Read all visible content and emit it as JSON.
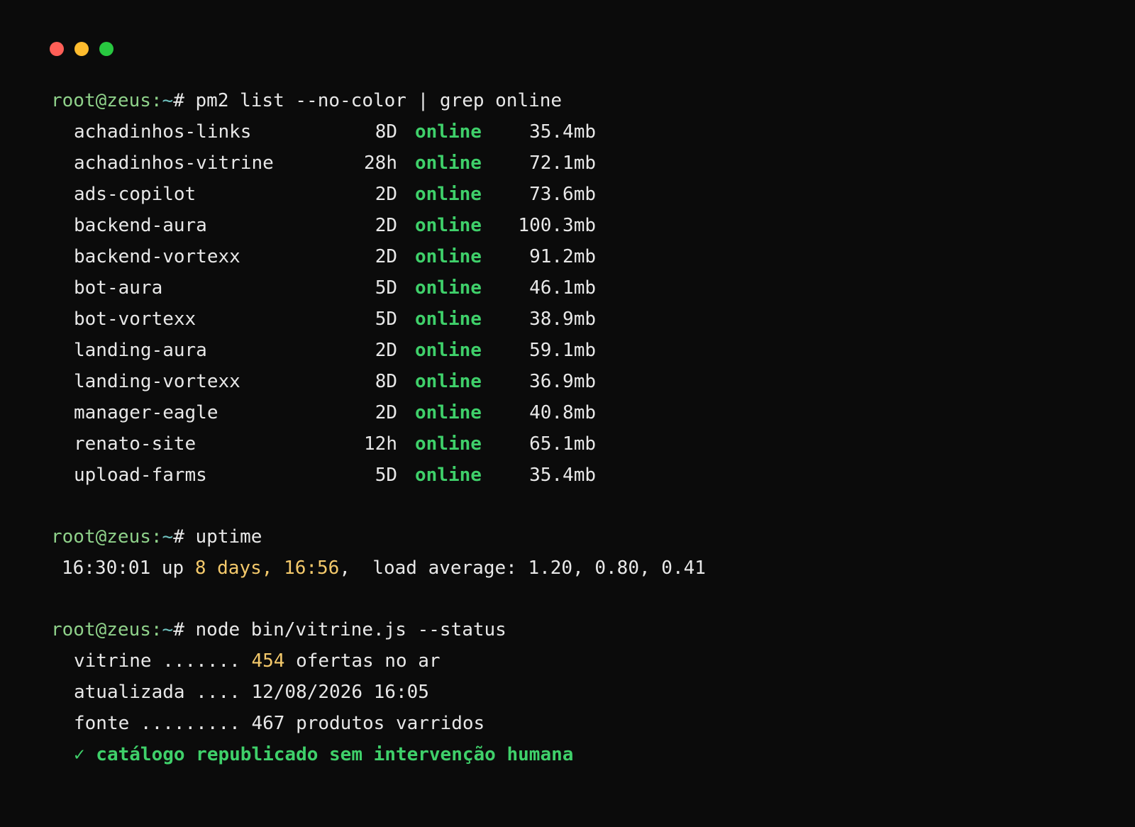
{
  "window_controls": {
    "close_color": "#ff5f57",
    "minimize_color": "#febc2e",
    "maximize_color": "#28c840"
  },
  "prompt": {
    "user_host": "root@zeus",
    "colon": ":",
    "tilde": "~",
    "hash": "# "
  },
  "commands": {
    "pm2": "pm2 list --no-color | grep online",
    "uptime": "uptime",
    "vitrine": "node bin/vitrine.js --status"
  },
  "processes": [
    {
      "name": "achadinhos-links",
      "uptime": "8D",
      "status": "online",
      "memory": "35.4mb"
    },
    {
      "name": "achadinhos-vitrine",
      "uptime": "28h",
      "status": "online",
      "memory": "72.1mb"
    },
    {
      "name": "ads-copilot",
      "uptime": "2D",
      "status": "online",
      "memory": "73.6mb"
    },
    {
      "name": "backend-aura",
      "uptime": "2D",
      "status": "online",
      "memory": "100.3mb"
    },
    {
      "name": "backend-vortexx",
      "uptime": "2D",
      "status": "online",
      "memory": "91.2mb"
    },
    {
      "name": "bot-aura",
      "uptime": "5D",
      "status": "online",
      "memory": "46.1mb"
    },
    {
      "name": "bot-vortexx",
      "uptime": "5D",
      "status": "online",
      "memory": "38.9mb"
    },
    {
      "name": "landing-aura",
      "uptime": "2D",
      "status": "online",
      "memory": "59.1mb"
    },
    {
      "name": "landing-vortexx",
      "uptime": "8D",
      "status": "online",
      "memory": "36.9mb"
    },
    {
      "name": "manager-eagle",
      "uptime": "2D",
      "status": "online",
      "memory": "40.8mb"
    },
    {
      "name": "renato-site",
      "uptime": "12h",
      "status": "online",
      "memory": "65.1mb"
    },
    {
      "name": "upload-farms",
      "uptime": "5D",
      "status": "online",
      "memory": "35.4mb"
    }
  ],
  "uptime_output": {
    "time": "16:30:01 up ",
    "duration": "8 days, 16:56",
    "rest": ",  load average: 1.20, 0.80, 0.41"
  },
  "vitrine_output": {
    "line1_prefix": "vitrine ....... ",
    "line1_count": "454",
    "line1_suffix": " ofertas no ar",
    "line2": "atualizada .... 12/08/2026 16:05",
    "line3": "fonte ......... 467 produtos varridos",
    "line4": "✓ catálogo republicado sem intervenção humana"
  },
  "colors": {
    "background": "#0b0b0b",
    "text": "#e8e8e8",
    "prompt_green": "#8fd18a",
    "status_green": "#3fd06a",
    "highlight_yellow": "#f4c96b"
  }
}
